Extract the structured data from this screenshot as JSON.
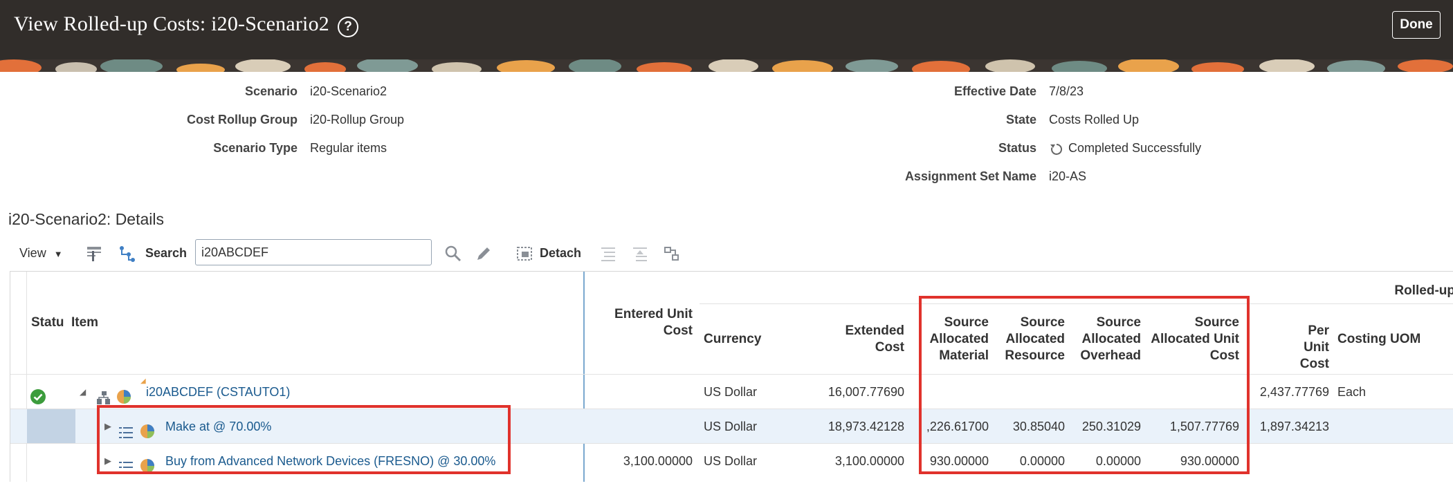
{
  "header": {
    "title": "View Rolled-up Costs: i20-Scenario2",
    "help_icon": "?",
    "done_label": "Done"
  },
  "fields_left": [
    {
      "label": "Scenario",
      "value": "i20-Scenario2"
    },
    {
      "label": "Cost Rollup Group",
      "value": "i20-Rollup Group"
    },
    {
      "label": "Scenario Type",
      "value": "Regular items"
    }
  ],
  "fields_right": [
    {
      "label": "Effective Date",
      "value": "7/8/23"
    },
    {
      "label": "State",
      "value": "Costs Rolled Up"
    },
    {
      "label": "Status",
      "value": "Completed Successfully",
      "icon": "refresh-icon"
    },
    {
      "label": "Assignment Set Name",
      "value": "i20-AS"
    }
  ],
  "details": {
    "title": "i20-Scenario2: Details"
  },
  "toolbar": {
    "view_label": "View",
    "search_label": "Search",
    "search_value": "i20ABCDEF",
    "detach_label": "Detach"
  },
  "table": {
    "group_header": "Rolled-up",
    "headers": {
      "status": "Statu",
      "item": "Item",
      "entered_unit_cost": "Entered Unit Cost",
      "currency": "Currency",
      "extended_cost": "Extended Cost",
      "src_material": "Source Allocated Material",
      "src_resource": "Source Allocated Resource",
      "src_overhead": "Source Allocated Overhead",
      "src_unit_cost": "Source Allocated Unit Cost",
      "per_unit_cost": "Per Unit Cost",
      "costing_uom": "Costing UOM"
    },
    "rows": [
      {
        "item": "i20ABCDEF (CSTAUTO1)",
        "entered_unit_cost": "",
        "currency": "US Dollar",
        "extended_cost": "16,007.77690",
        "src_material": "",
        "src_resource": "",
        "src_overhead": "",
        "src_unit_cost": "",
        "per_unit_cost": "2,437.77769",
        "costing_uom": "Each"
      },
      {
        "item": "Make at @ 70.00%",
        "entered_unit_cost": "",
        "currency": "US Dollar",
        "extended_cost": "18,973.42128",
        "src_material": ",226.61700",
        "src_resource": "30.85040",
        "src_overhead": "250.31029",
        "src_unit_cost": "1,507.77769",
        "per_unit_cost": "1,897.34213",
        "costing_uom": ""
      },
      {
        "item": "Buy from Advanced Network Devices (FRESNO) @ 30.00%",
        "entered_unit_cost": "3,100.00000",
        "currency": "US Dollar",
        "extended_cost": "3,100.00000",
        "src_material": "930.00000",
        "src_resource": "0.00000",
        "src_overhead": "0.00000",
        "src_unit_cost": "930.00000",
        "per_unit_cost": "",
        "costing_uom": ""
      }
    ]
  },
  "colors": {
    "header_bg": "#312d2a",
    "link": "#1a5a8e",
    "highlight_box": "#e0322c",
    "selected_row": "#eaf2fa",
    "success_green": "#3c9c3c"
  }
}
